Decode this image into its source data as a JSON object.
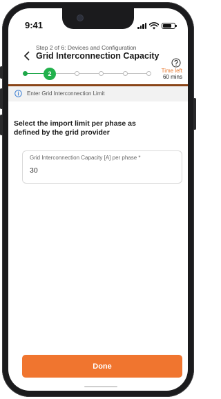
{
  "status_bar": {
    "time": "9:41"
  },
  "header": {
    "step_label": "Step 2 of 6: Devices and Configuration",
    "title": "Grid Interconnection Capacity",
    "back_icon": "chevron-left-icon",
    "help_icon": "question-circle-icon"
  },
  "stepper": {
    "current_step": "2",
    "time_left_label": "Time left",
    "time_left_value": "60 mins",
    "accent_color": "#1fa84a"
  },
  "info_banner": {
    "icon": "info-icon",
    "text": "Enter Grid Interconnection Limit"
  },
  "prompt": "Select the import limit per phase as defined by the grid provider",
  "field": {
    "label": "Grid Interconnection Capacity [A] per phase *",
    "value": "30"
  },
  "done_label": "Done",
  "colors": {
    "primary": "#f0752f",
    "success": "#22b14c",
    "accent_bar": "#8a4518"
  }
}
